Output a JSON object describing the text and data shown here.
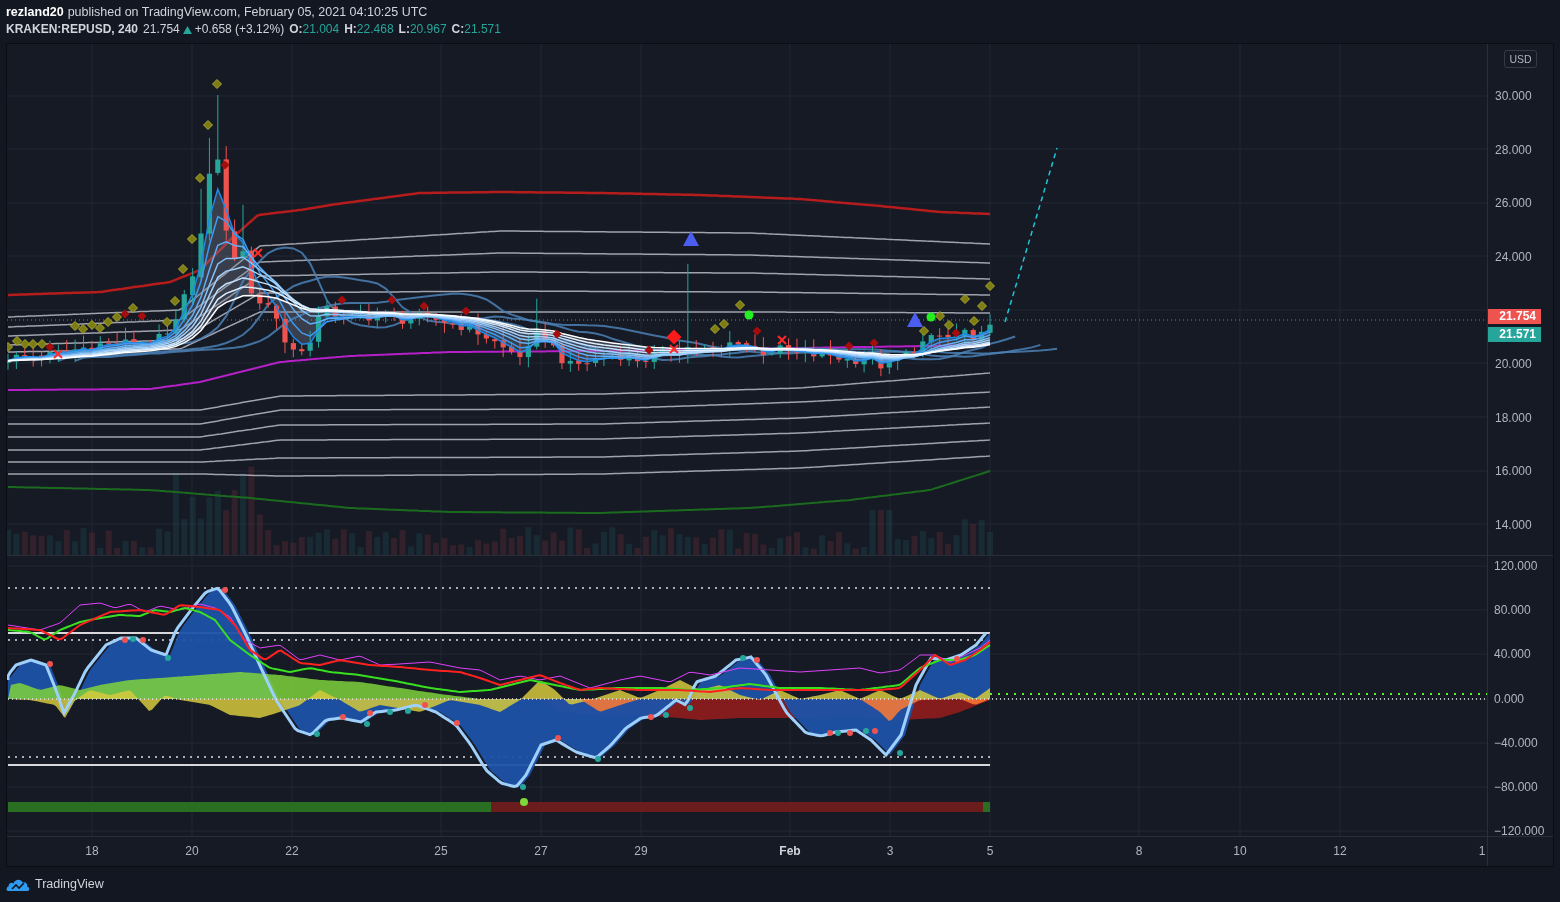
{
  "header": {
    "author": "rezland20",
    "published": "published on TradingView.com, February 05, 2021 04:10:25 UTC"
  },
  "legend": {
    "symbol": "KRAKEN:REPUSD, 240",
    "last": "21.754",
    "rising": true,
    "change": "+0.658 (+3.12%)",
    "ohlc": [
      {
        "label": "O:",
        "value": "21.004"
      },
      {
        "label": "H:",
        "value": "22.468"
      },
      {
        "label": "L:",
        "value": "20.967"
      },
      {
        "label": "C:",
        "value": "21.571"
      }
    ]
  },
  "price_pane": {
    "currency": "USD",
    "axis_upper": [
      "30.000",
      "28.000",
      "26.000",
      "24.000"
    ],
    "price_labels": [
      {
        "value": "21.754",
        "color": "#ef5350"
      },
      {
        "value": "21.571",
        "color": "#26a69a"
      }
    ],
    "axis_lower": [
      "20.000",
      "18.000",
      "16.000",
      "14.000"
    ]
  },
  "oscillator_pane": {
    "axis": [
      "120.000",
      "80.000",
      "40.000",
      "0.000",
      "−40.000",
      "−80.000",
      "−120.000"
    ]
  },
  "time_axis": [
    {
      "label": "18",
      "kind": "day"
    },
    {
      "label": "20",
      "kind": "day"
    },
    {
      "label": "22",
      "kind": "day"
    },
    {
      "label": "25",
      "kind": "day"
    },
    {
      "label": "27",
      "kind": "day"
    },
    {
      "label": "29",
      "kind": "day"
    },
    {
      "label": "Feb",
      "kind": "month"
    },
    {
      "label": "3",
      "kind": "day"
    },
    {
      "label": "5",
      "kind": "day"
    },
    {
      "label": "8",
      "kind": "day"
    },
    {
      "label": "10",
      "kind": "day"
    },
    {
      "label": "12",
      "kind": "day"
    },
    {
      "label": "1",
      "kind": "day"
    }
  ],
  "footer": {
    "brand": "TradingView"
  }
}
